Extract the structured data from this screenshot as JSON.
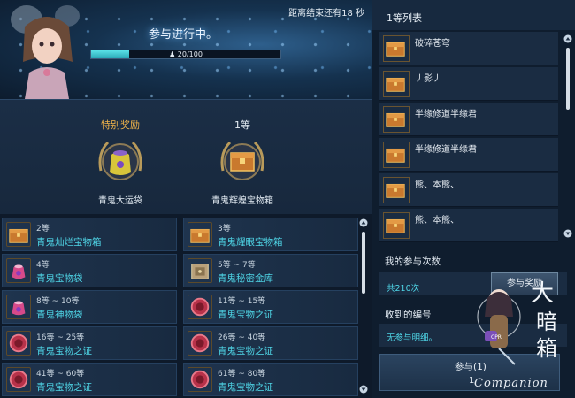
{
  "banner": {
    "countdown": "距离结束还有18 秒",
    "status": "参与进行中。",
    "participants": "20/100",
    "progress_fraction": 0.2
  },
  "special_reward": {
    "title": "特别奖励",
    "item": "青鬼大运袋",
    "title_color": "#f0b44a"
  },
  "first_reward": {
    "title": "1等",
    "item": "青鬼辉煌宝物箱"
  },
  "rewards_list": [
    {
      "rank": "2等",
      "item": "青鬼灿烂宝物箱",
      "icon": "chest-icon"
    },
    {
      "rank": "3等",
      "item": "青鬼耀眼宝物箱",
      "icon": "chest-icon"
    },
    {
      "rank": "4等",
      "item": "青鬼宝物袋",
      "icon": "pouch-icon"
    },
    {
      "rank": "5等 ~ 7等",
      "item": "青鬼秘密金库",
      "icon": "vault-icon"
    },
    {
      "rank": "8等 ~ 10等",
      "item": "青鬼神物袋",
      "icon": "pouch-icon"
    },
    {
      "rank": "11等 ~ 15等",
      "item": "青鬼宝物之证",
      "icon": "token-icon"
    },
    {
      "rank": "16等 ~ 25等",
      "item": "青鬼宝物之证",
      "icon": "token-icon"
    },
    {
      "rank": "26等 ~ 40等",
      "item": "青鬼宝物之证",
      "icon": "token-icon"
    },
    {
      "rank": "41等 ~ 60等",
      "item": "青鬼宝物之证",
      "icon": "token-icon"
    },
    {
      "rank": "61等 ~ 80等",
      "item": "青鬼宝物之证",
      "icon": "token-icon"
    }
  ],
  "winners": {
    "title": "1等列表",
    "names": [
      "破碎苍穹",
      "丿影丿",
      "半缘修道半缘君",
      "半缘修道半缘君",
      "熊、本熊、",
      "熊、本熊、"
    ]
  },
  "participation": {
    "label": "我的参与次数",
    "count": "共210次",
    "join_button": "参与奖励"
  },
  "received": {
    "label": "收到的编号",
    "none": "无参与明细。"
  },
  "bottom_button": {
    "line1": "参与(1)",
    "line2": "1"
  },
  "watermark": {
    "caption": "Companion",
    "title": "大 暗 箱",
    "brand": "CPR"
  },
  "colors": {
    "accent_cyan": "#4fd5e6",
    "gold": "#f0b44a",
    "panel": "#132236"
  }
}
